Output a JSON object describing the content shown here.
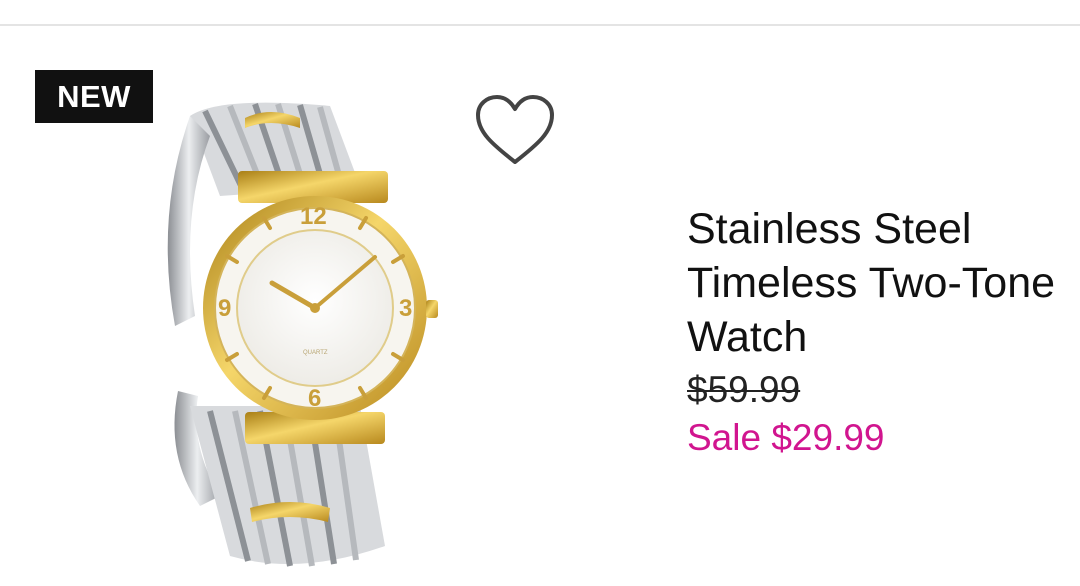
{
  "product": {
    "badge": "NEW",
    "title": "Stainless Steel\nTimeless Two-Tone\nWatch",
    "original_price": "$59.99",
    "sale_price": "Sale $29.99",
    "image_icon": "two-tone-watch",
    "favorite_icon": "heart-outline-icon"
  },
  "colors": {
    "sale": "#d1158f",
    "badge_bg": "#111111",
    "divider": "#e4e4e4"
  }
}
